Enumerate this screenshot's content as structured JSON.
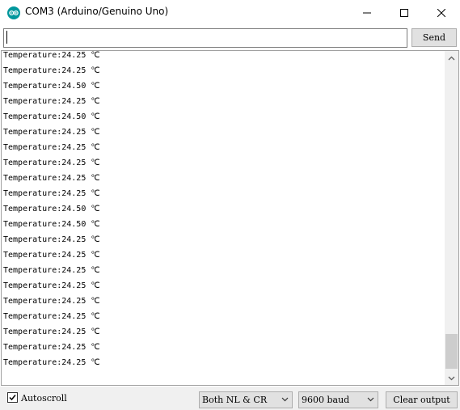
{
  "window": {
    "title": "COM3 (Arduino/Genuino Uno)",
    "icon": "arduino-logo-icon",
    "accent": "#00979c"
  },
  "input": {
    "value": "",
    "send_label": "Send"
  },
  "output": {
    "lines": [
      "Temperature:24.25 ℃",
      "Temperature:24.25 ℃",
      "Temperature:24.50 ℃",
      "Temperature:24.25 ℃",
      "Temperature:24.50 ℃",
      "Temperature:24.25 ℃",
      "Temperature:24.25 ℃",
      "Temperature:24.25 ℃",
      "Temperature:24.25 ℃",
      "Temperature:24.25 ℃",
      "Temperature:24.50 ℃",
      "Temperature:24.50 ℃",
      "Temperature:24.25 ℃",
      "Temperature:24.25 ℃",
      "Temperature:24.25 ℃",
      "Temperature:24.25 ℃",
      "Temperature:24.25 ℃",
      "Temperature:24.25 ℃",
      "Temperature:24.25 ℃",
      "Temperature:24.25 ℃",
      "Temperature:24.25 ℃"
    ]
  },
  "footer": {
    "autoscroll_label": "Autoscroll",
    "autoscroll_checked": true,
    "line_ending": "Both NL & CR",
    "baud_rate": "9600 baud",
    "clear_label": "Clear output"
  }
}
